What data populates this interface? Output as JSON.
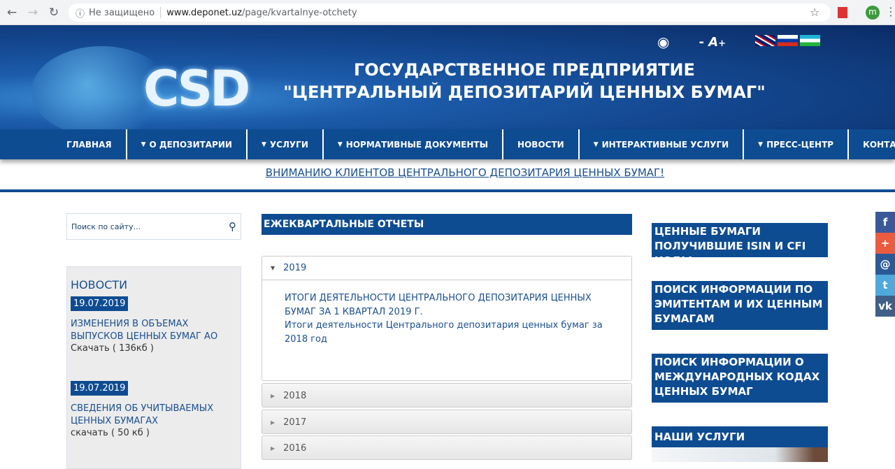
{
  "browser": {
    "security": "Не защищено",
    "url_host": "www.deponet.uz",
    "url_path": "/page/kvartalnye-otchety",
    "profile": "m"
  },
  "header": {
    "logo": "CSD",
    "title_line1": "ГОСУДАРСТВЕННОЕ ПРЕДПРИЯТИЕ",
    "title_line2": "\"ЦЕНТРАЛЬНЫЙ ДЕПОЗИТАРИЙ ЦЕННЫХ БУМАГ\"",
    "font_minus": "-",
    "font_label": "A",
    "font_plus": "+"
  },
  "nav": [
    {
      "label": "ГЛАВНАЯ",
      "dropdown": false
    },
    {
      "label": "О ДЕПОЗИТАРИИ",
      "dropdown": true
    },
    {
      "label": "УСЛУГИ",
      "dropdown": true
    },
    {
      "label": "НОРМАТИВНЫЕ ДОКУМЕНТЫ",
      "dropdown": true
    },
    {
      "label": "НОВОСТИ",
      "dropdown": false
    },
    {
      "label": "ИНТЕРАКТИВНЫЕ УСЛУГИ",
      "dropdown": true
    },
    {
      "label": "ПРЕСС-ЦЕНТР",
      "dropdown": true
    },
    {
      "label": "КОНТАКТЫ",
      "dropdown": false
    }
  ],
  "notice": "ВНИМАНИЮ КЛИЕНТОВ ЦЕНТРАЛЬНОГО ДЕПОЗИТАРИЯ ЦЕННЫХ БУМАГ!",
  "search": {
    "placeholder": "Поиск по сайту..."
  },
  "news": {
    "heading": "НОВОСТИ",
    "items": [
      {
        "date": "19.07.2019",
        "title": "ИЗМЕНЕНИЯ В ОБЪЕМАХ ВЫПУСКОВ ЦЕННЫХ БУМАГ АО",
        "download": "Скачать ( 136кб )"
      },
      {
        "date": "19.07.2019",
        "title": "СВЕДЕНИЯ ОБ УЧИТЫВАЕМЫХ ЦЕННЫХ БУМАГАХ",
        "download": "скачать ( 50 кб )"
      }
    ]
  },
  "main": {
    "heading": "ЕЖЕКВАРТАЛЬНЫЕ ОТЧЕТЫ",
    "years": [
      {
        "year": "2019",
        "open": true,
        "links": [
          "ИТОГИ ДЕЯТЕЛЬНОСТИ ЦЕНТРАЛЬНОГО ДЕПОЗИТАРИЯ ЦЕННЫХ БУМАГ ЗА 1 КВАРТАЛ 2019 Г.",
          "Итоги деятельности Центрального депозитария ценных бумаг за 2018 год"
        ]
      },
      {
        "year": "2018"
      },
      {
        "year": "2017"
      },
      {
        "year": "2016"
      }
    ]
  },
  "right": [
    "ЦЕННЫЕ БУМАГИ ПОЛУЧИВШИЕ ISIN И CFI КОДЫ",
    "ПОИСК ИНФОРМАЦИИ ПО ЭМИТЕНТАМ И ИХ ЦЕННЫМ БУМАГАМ",
    "ПОИСК ИНФОРМАЦИИ О МЕЖДУНАРОДНЫХ КОДАХ ЦЕННЫХ БУМАГ",
    "НАШИ УСЛУГИ"
  ],
  "social": [
    {
      "icon": "facebook-icon",
      "glyph": "f",
      "color": "#3b5998"
    },
    {
      "icon": "plus-icon",
      "glyph": "+",
      "color": "#eb5b40"
    },
    {
      "icon": "mail-icon",
      "glyph": "@",
      "color": "#2a5a96"
    },
    {
      "icon": "twitter-icon",
      "glyph": "t",
      "color": "#4fa9dc"
    },
    {
      "icon": "vk-icon",
      "glyph": "vk",
      "color": "#3f5f86"
    }
  ]
}
